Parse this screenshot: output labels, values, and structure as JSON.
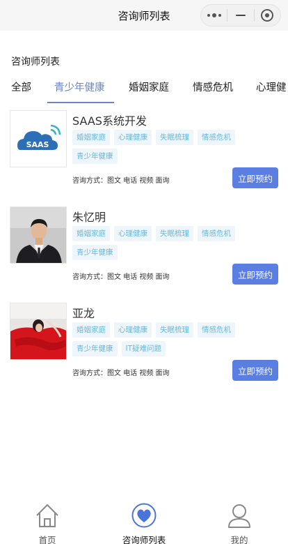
{
  "header": {
    "title": "咨询师列表"
  },
  "capsule": {
    "more": "more-icon",
    "minimize": "minimize-icon",
    "close": "target-icon"
  },
  "section_title": "咨询师列表",
  "tabs": [
    {
      "label": "全部"
    },
    {
      "label": "青少年健康"
    },
    {
      "label": "婚姻家庭"
    },
    {
      "label": "情感危机"
    },
    {
      "label": "心理健"
    }
  ],
  "active_tab": "青少年健康",
  "counselors": [
    {
      "name": "SAAS系统开发",
      "avatar_text": "SAAS",
      "tags": [
        "婚姻家庭",
        "心理健康",
        "失眠梳理",
        "情感危机",
        "青少年健康"
      ],
      "modes": "咨询方式：图文 电话 视频 面询",
      "button": "立即预约"
    },
    {
      "name": "朱忆明",
      "tags": [
        "婚姻家庭",
        "心理健康",
        "失眠梳理",
        "情感危机",
        "青少年健康"
      ],
      "modes": "咨询方式：图文 电话 视频 面询",
      "button": "立即预约"
    },
    {
      "name": "亚龙",
      "tags": [
        "婚姻家庭",
        "心理健康",
        "失眠梳理",
        "情感危机",
        "青少年健康",
        "IT疑难问题"
      ],
      "modes": "咨询方式：图文 电话 视频 面询",
      "button": "立即预约"
    }
  ],
  "tabbar": [
    {
      "label": "首页",
      "icon": "home-icon"
    },
    {
      "label": "咨询师列表",
      "icon": "heart-icon"
    },
    {
      "label": "我的",
      "icon": "user-icon"
    }
  ],
  "colors": {
    "accent": "#6a85c8",
    "button": "#5b7ee2",
    "tag_text": "#69b8de",
    "tag_bg": "#eef6fc"
  }
}
